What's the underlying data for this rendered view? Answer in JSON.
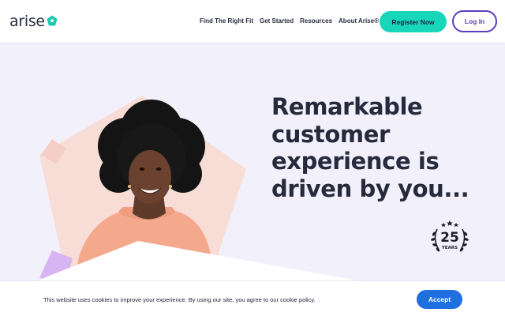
{
  "header": {
    "logo_text": "arise",
    "nav": [
      "Find The Right Fit",
      "Get Started",
      "Resources",
      "About Arise®"
    ],
    "register_label": "Register Now",
    "login_label": "Log In"
  },
  "hero": {
    "headline_lines": [
      "Remarkable",
      "customer",
      "experience is",
      "driven by you..."
    ],
    "badge_number": "25",
    "badge_text": "YEARS"
  },
  "cookie": {
    "message": "This website uses cookies to improve your experience. By using our site, you agree to our cookie policy.",
    "accept_label": "Accept"
  },
  "colors": {
    "brand_teal": "#18d6b8",
    "brand_purple": "#5b3fbf",
    "accept_blue": "#1f6fe0",
    "background": "#f2f0fb",
    "shape_peach": "#f8ddd6"
  }
}
